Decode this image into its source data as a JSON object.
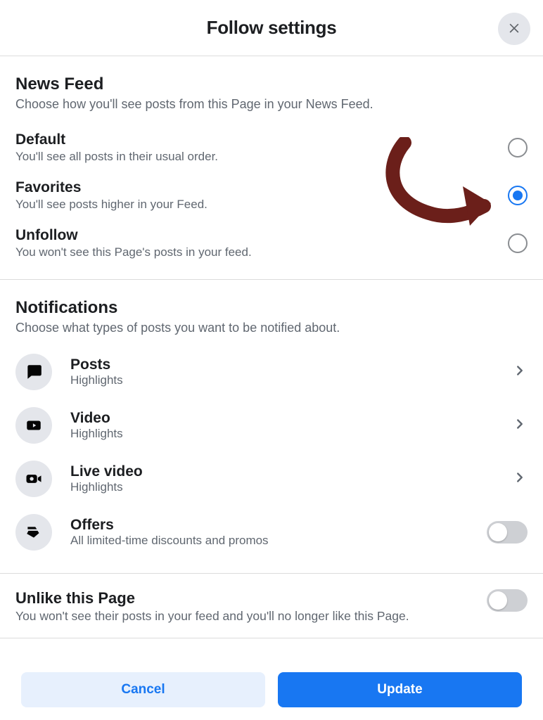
{
  "header": {
    "title": "Follow settings"
  },
  "newsfeed": {
    "heading": "News Feed",
    "desc": "Choose how you'll see posts from this Page in your News Feed.",
    "options": [
      {
        "title": "Default",
        "sub": "You'll see all posts in their usual order.",
        "selected": false
      },
      {
        "title": "Favorites",
        "sub": "You'll see posts higher in your Feed.",
        "selected": true
      },
      {
        "title": "Unfollow",
        "sub": "You won't see this Page's posts in your feed.",
        "selected": false
      }
    ]
  },
  "notifications": {
    "heading": "Notifications",
    "desc": "Choose what types of posts you want to be notified about.",
    "items": [
      {
        "title": "Posts",
        "sub": "Highlights"
      },
      {
        "title": "Video",
        "sub": "Highlights"
      },
      {
        "title": "Live video",
        "sub": "Highlights"
      },
      {
        "title": "Offers",
        "sub": "All limited-time discounts and promos"
      }
    ]
  },
  "unlike": {
    "title": "Unlike this Page",
    "sub": "You won't see their posts in your feed and you'll no longer like this Page."
  },
  "footer": {
    "cancel": "Cancel",
    "update": "Update"
  }
}
